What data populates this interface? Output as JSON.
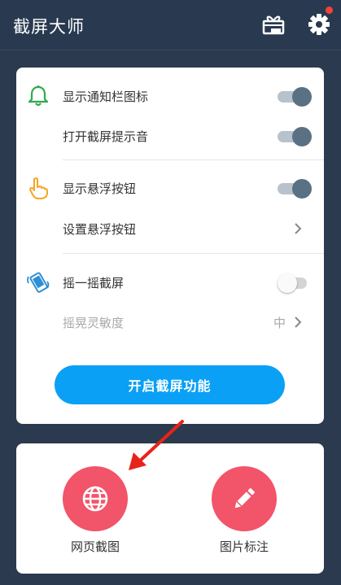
{
  "app": {
    "title": "截屏大师"
  },
  "colors": {
    "accent_blue": "#0aa0f5",
    "tool_red": "#f2546a",
    "toggle_on_track": "#b8c2cc",
    "toggle_on_knob": "#5a7184",
    "toggle_off_track": "#d4d4d4",
    "toggle_off_knob": "#fafafa",
    "notification_dot": "#f44336",
    "annotation_arrow": "#e8231b"
  },
  "header": {
    "icons": [
      "gift-box-icon",
      "settings-gear-icon"
    ],
    "notification_dot": true
  },
  "settings": {
    "rows": [
      {
        "label": "显示通知栏图标",
        "icon": "bell-icon",
        "control": "toggle",
        "on": true
      },
      {
        "label": "打开截屏提示音",
        "control": "toggle",
        "on": true
      },
      {
        "label": "显示悬浮按钮",
        "icon": "pointing-hand-icon",
        "control": "toggle",
        "on": true
      },
      {
        "label": "设置悬浮按钮",
        "control": "chevron"
      },
      {
        "label": "摇一摇截屏",
        "icon": "shaking-phone-icon",
        "control": "toggle",
        "on": false
      },
      {
        "label": "摇晃灵敏度",
        "control": "value-chevron",
        "value": "中",
        "disabled": true
      }
    ]
  },
  "main_button": {
    "label": "开启截屏功能"
  },
  "tools": [
    {
      "label": "网页截图",
      "icon": "globe-icon"
    },
    {
      "label": "图片标注",
      "icon": "pencil-icon"
    }
  ]
}
